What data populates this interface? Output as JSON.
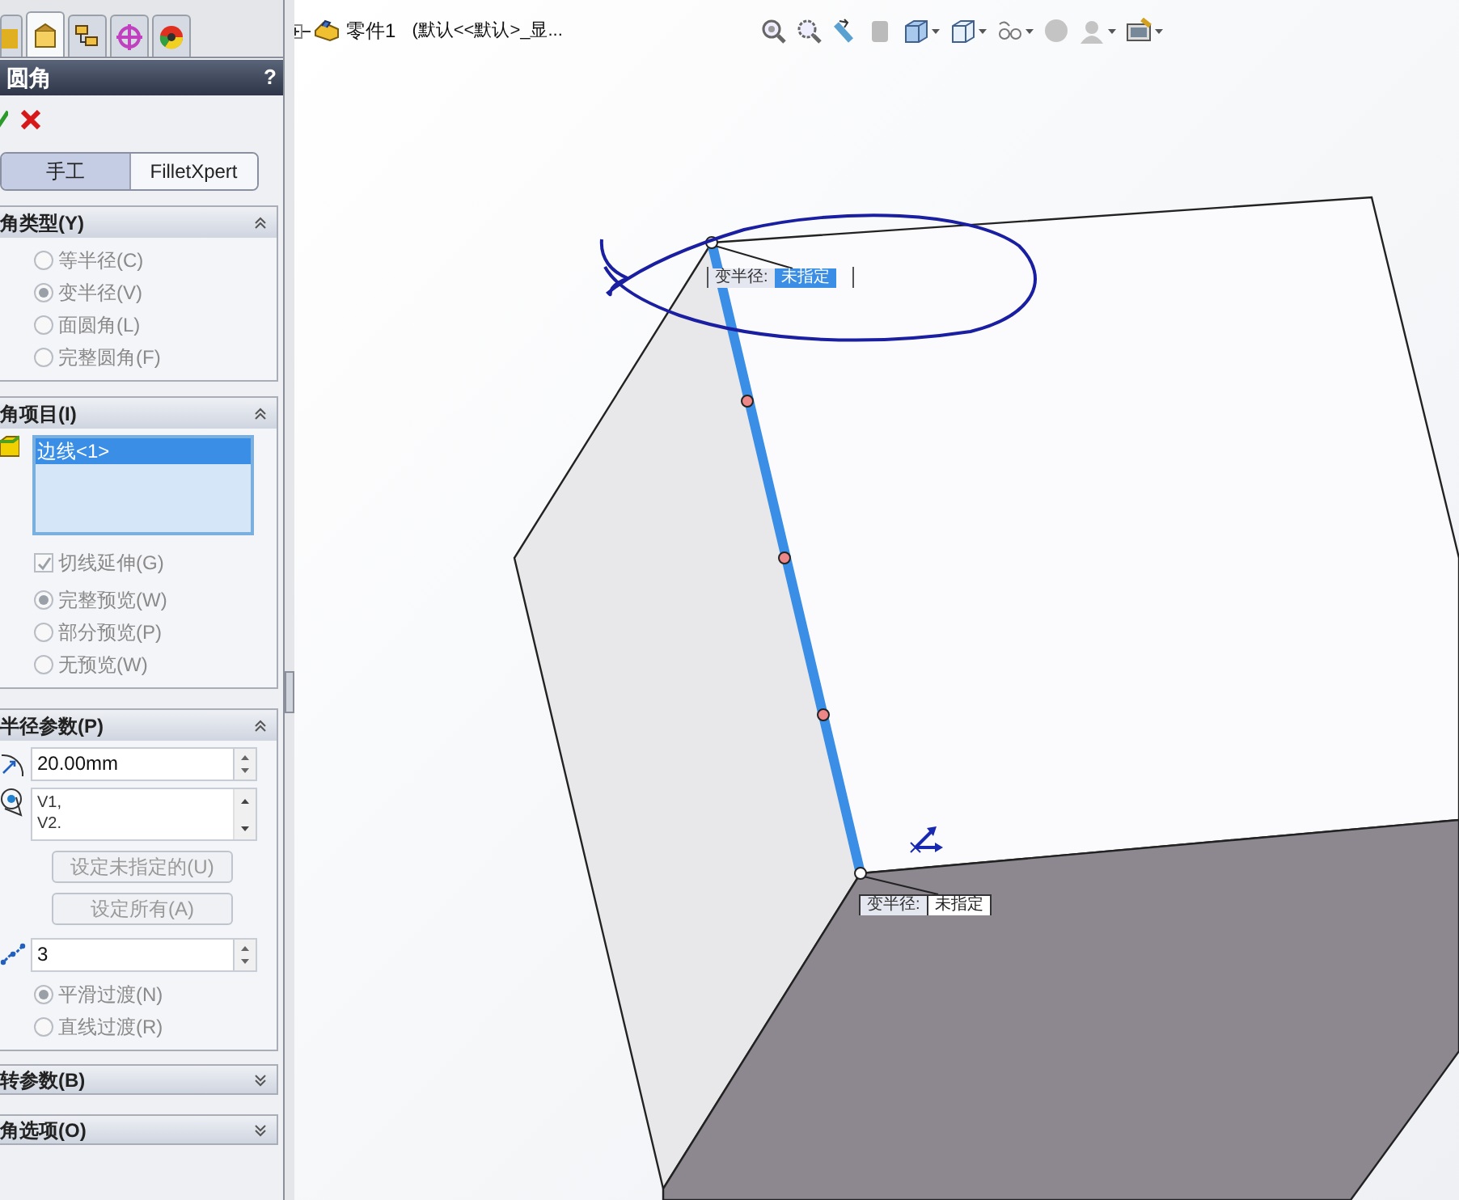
{
  "panel_tabs": [
    {
      "selected": false
    },
    {
      "selected": true
    },
    {
      "selected": false
    },
    {
      "selected": false
    },
    {
      "selected": false
    }
  ],
  "property_manager": {
    "title": "圆角",
    "help": "?"
  },
  "mode_buttons": [
    {
      "label": "手工",
      "selected": true
    },
    {
      "label": "FilletXpert",
      "selected": false
    }
  ],
  "sections": [
    {
      "title": "角类型(Y)",
      "expanded": true,
      "items": [
        {
          "kind": "radio",
          "label": "等半径(C)",
          "selected": false
        },
        {
          "kind": "radio",
          "label": "变半径(V)",
          "selected": true
        },
        {
          "kind": "radio",
          "label": "面圆角(L)",
          "selected": false
        },
        {
          "kind": "radio",
          "label": "完整圆角(F)",
          "selected": false
        }
      ]
    },
    {
      "title": "角项目(I)",
      "expanded": true,
      "items": [
        {
          "kind": "edge-list",
          "entries": [
            {
              "label": "边线<1>",
              "selected": true
            }
          ]
        },
        {
          "kind": "checkbox",
          "label": "切线延伸(G)",
          "checked": true
        },
        {
          "kind": "radio",
          "label": "完整预览(W)",
          "selected": true
        },
        {
          "kind": "radio",
          "label": "部分预览(P)",
          "selected": false
        },
        {
          "kind": "radio",
          "label": "无预览(W)",
          "selected": false
        }
      ]
    },
    {
      "title": "半径参数(P)",
      "expanded": true,
      "items": [
        {
          "kind": "radius-field",
          "value": "20.00mm"
        },
        {
          "kind": "vertex-list",
          "entries": [
            {
              "label": "V1,",
              "selected": false
            },
            {
              "label": "V2.",
              "selected": false
            }
          ]
        },
        {
          "kind": "button",
          "label": "设定未指定的(U)"
        },
        {
          "kind": "button",
          "label": "设定所有(A)"
        },
        {
          "kind": "count-field",
          "value": "3"
        },
        {
          "kind": "radio",
          "label": "平滑过渡(N)",
          "selected": true
        },
        {
          "kind": "radio",
          "label": "直线过渡(R)",
          "selected": false
        }
      ]
    },
    {
      "title": "转参数(B)",
      "expanded": false
    },
    {
      "title": "角选项(O)",
      "expanded": false
    }
  ],
  "tree": {
    "part_name": "零件1",
    "configuration": "(默认<<默认>_显..."
  },
  "callouts": [
    {
      "label": "变半径:",
      "value": "未指定",
      "selected": true
    },
    {
      "label": "变半径:",
      "value": "未指定",
      "selected": false
    }
  ]
}
